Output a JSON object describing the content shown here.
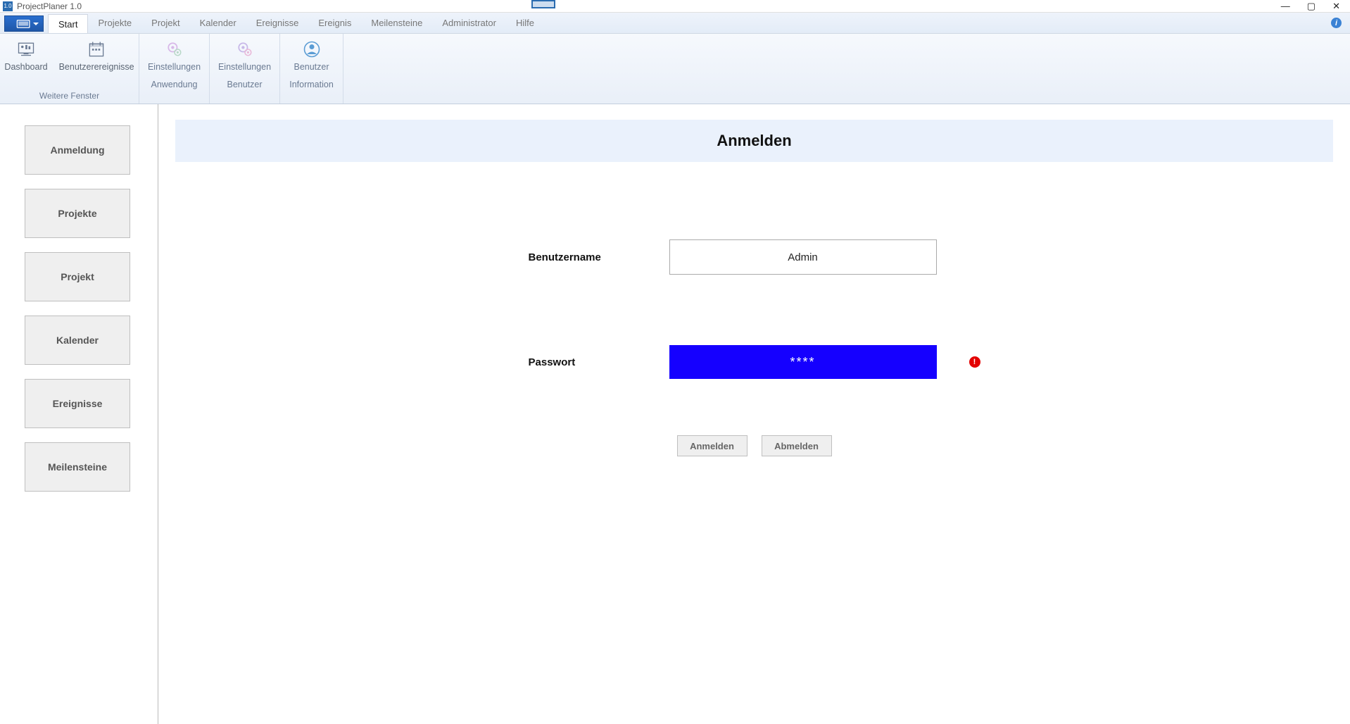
{
  "window": {
    "title": "ProjectPlaner 1.0"
  },
  "tabs": [
    {
      "label": "Start",
      "active": true
    },
    {
      "label": "Projekte",
      "active": false
    },
    {
      "label": "Projekt",
      "active": false
    },
    {
      "label": "Kalender",
      "active": false
    },
    {
      "label": "Ereignisse",
      "active": false
    },
    {
      "label": "Ereignis",
      "active": false
    },
    {
      "label": "Meilensteine",
      "active": false
    },
    {
      "label": "Administrator",
      "active": false
    },
    {
      "label": "Hilfe",
      "active": false
    }
  ],
  "ribbon": {
    "group1": {
      "label": "Weitere Fenster",
      "items": [
        {
          "label": "Dashboard"
        },
        {
          "label": "Benutzerereignisse"
        }
      ]
    },
    "group2": {
      "items": [
        {
          "line1": "Einstellungen",
          "line2": "Anwendung"
        }
      ]
    },
    "group3": {
      "items": [
        {
          "line1": "Einstellungen",
          "line2": "Benutzer"
        }
      ]
    },
    "group4": {
      "items": [
        {
          "line1": "Benutzer",
          "line2": "Information"
        }
      ]
    }
  },
  "sidebar": {
    "items": [
      {
        "label": "Anmeldung"
      },
      {
        "label": "Projekte"
      },
      {
        "label": "Projekt"
      },
      {
        "label": "Kalender"
      },
      {
        "label": "Ereignisse"
      },
      {
        "label": "Meilensteine"
      }
    ]
  },
  "page": {
    "title": "Anmelden",
    "username_label": "Benutzername",
    "username_value": "Admin",
    "password_label": "Passwort",
    "password_value": "****",
    "error_tooltip": "!",
    "login_button": "Anmelden",
    "logout_button": "Abmelden"
  }
}
